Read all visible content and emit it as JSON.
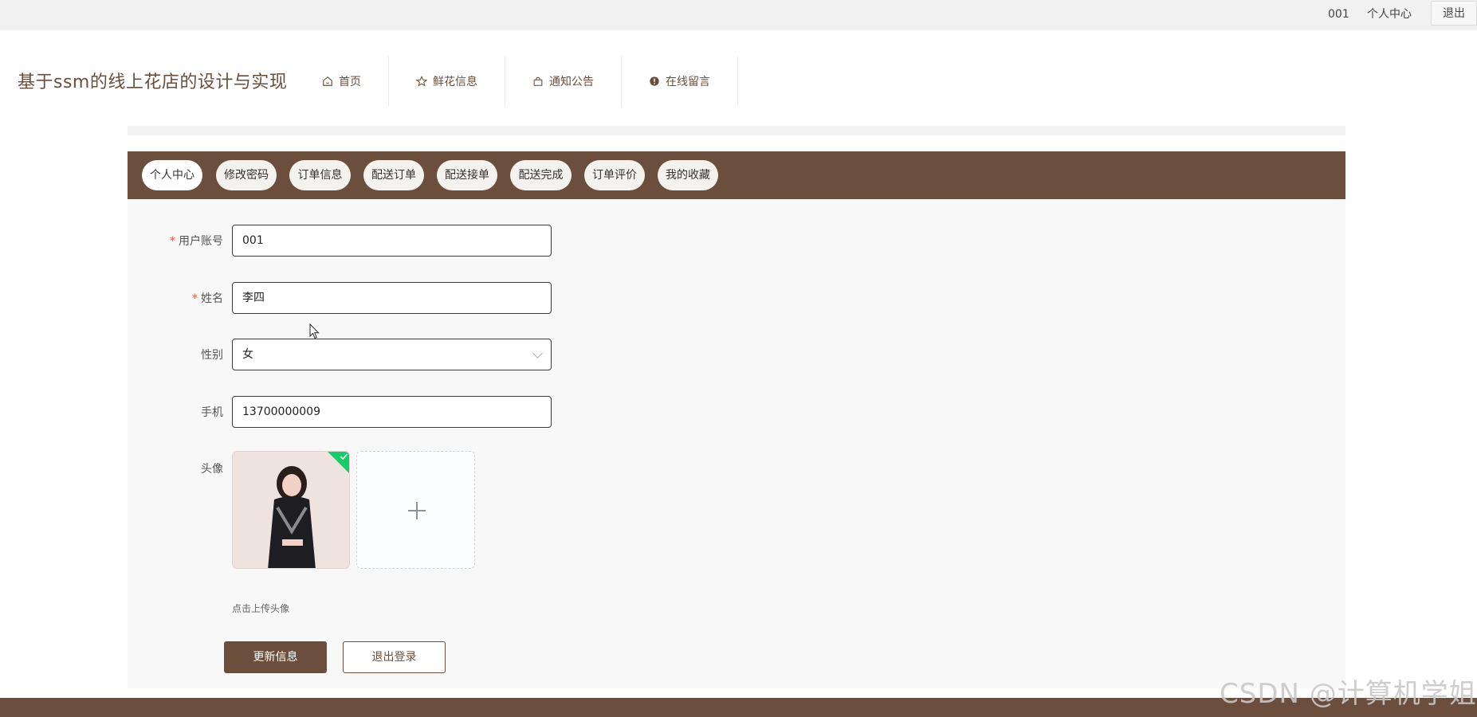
{
  "topbar": {
    "username": "001",
    "personal_center": "个人中心",
    "logout": "退出"
  },
  "header": {
    "site_title": "基于ssm的线上花店的设计与实现",
    "nav": [
      {
        "label": "首页",
        "icon": "home-icon"
      },
      {
        "label": "鲜花信息",
        "icon": "star-icon"
      },
      {
        "label": "通知公告",
        "icon": "bag-icon"
      },
      {
        "label": "在线留言",
        "icon": "info-circle-icon"
      }
    ]
  },
  "tabs": [
    {
      "label": "个人中心",
      "active": true
    },
    {
      "label": "修改密码",
      "active": false
    },
    {
      "label": "订单信息",
      "active": false
    },
    {
      "label": "配送订单",
      "active": false
    },
    {
      "label": "配送接单",
      "active": false
    },
    {
      "label": "配送完成",
      "active": false
    },
    {
      "label": "订单评价",
      "active": false
    },
    {
      "label": "我的收藏",
      "active": false
    }
  ],
  "form": {
    "account_label": "用户账号",
    "account_value": "001",
    "name_label": "姓名",
    "name_value": "李四",
    "gender_label": "性别",
    "gender_value": "女",
    "phone_label": "手机",
    "phone_value": "13700000009",
    "avatar_label": "头像",
    "upload_tip": "点击上传头像",
    "required_mark": "*"
  },
  "buttons": {
    "update": "更新信息",
    "logout": "退出登录"
  },
  "watermark": "CSDN @计算机学姐",
  "colors": {
    "brand": "#6b4f3c",
    "success": "#13ce66",
    "required": "#e05a47"
  }
}
